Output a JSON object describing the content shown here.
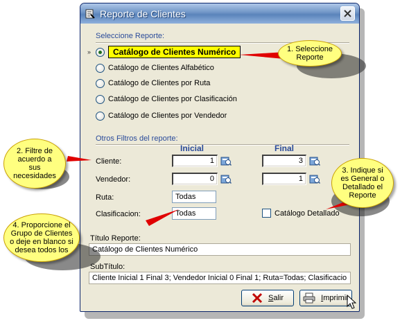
{
  "window": {
    "title": "Reporte de Clientes",
    "title_icon": "report-app-icon",
    "close_icon": "close-icon"
  },
  "report_section": {
    "label": "Seleccione Reporte:",
    "options": [
      {
        "label": "Catálogo de Clientes Numérico",
        "selected": true
      },
      {
        "label": "Catálogo de Clientes Alfabético",
        "selected": false
      },
      {
        "label": "Catálogo de Clientes por Ruta",
        "selected": false
      },
      {
        "label": "Catálogo de Clientes por Clasificación",
        "selected": false
      },
      {
        "label": "Catálogo de Clientes por Vendedor",
        "selected": false
      }
    ],
    "current_marker": "»"
  },
  "filters": {
    "label": "Otros Filtros del reporte:",
    "col_initial": "Inicial",
    "col_final": "Final",
    "cliente": {
      "label": "Cliente:",
      "initial": "1",
      "final": "3"
    },
    "vendedor": {
      "label": "Vendedor:",
      "initial": "0",
      "final": "1"
    },
    "ruta": {
      "label": "Ruta:",
      "value": "Todas"
    },
    "clasificacion": {
      "label": "Clasificacion:",
      "value": "Todas"
    },
    "detallado": {
      "label": "Catálogo Detallado",
      "checked": false
    }
  },
  "titles": {
    "titulo_label": "Título Reporte:",
    "titulo_value": "Catálogo de Clientes Numérico",
    "subtitulo_label": "SubTítulo:",
    "subtitulo_value": "Cliente Inicial 1 Final 3;  Vendedor Inicial 0 Final 1;  Ruta=Todas;  Clasificacio"
  },
  "buttons": {
    "salir": {
      "prefix": "",
      "accel": "S",
      "rest": "alir"
    },
    "imprimir": {
      "prefix": "",
      "accel": "I",
      "rest": "mprimir"
    }
  },
  "callouts": {
    "c1": "1. Seleccione Reporte",
    "c2": "2. Filtre de acuerdo a sus necesidades",
    "c3": "3. Indique si es General o Detallado el Reporte",
    "c4": "4. Proporcione el Grupo de Clientes o deje en blanco si desea todos los"
  },
  "colors": {
    "selected_highlight": "#ffff00",
    "callout_fill": "#ffff80",
    "pointer_red": "#e00000",
    "section_label": "#2a4b9a"
  }
}
